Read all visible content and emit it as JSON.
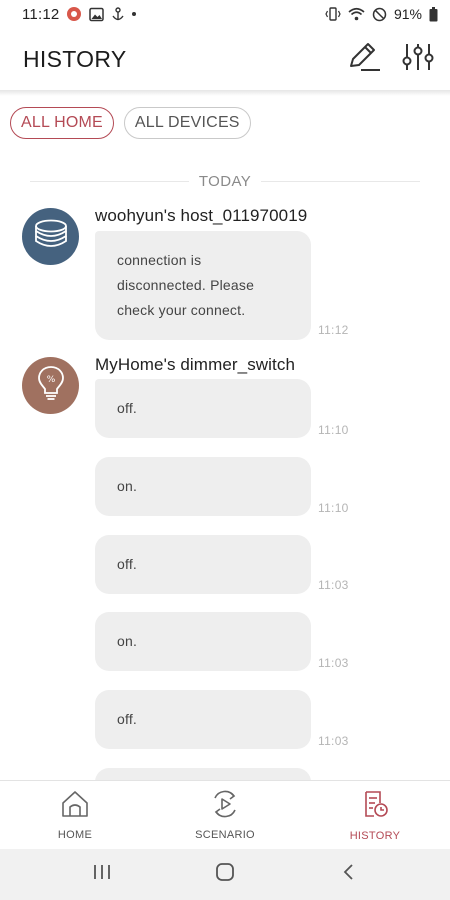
{
  "status_bar": {
    "time": "11:12",
    "battery": "91%",
    "left_icons": [
      "app-notification-icon",
      "gallery-icon",
      "anchor-icon",
      "dot-icon"
    ],
    "right_icons": [
      "vibrate-icon",
      "wifi-icon",
      "do-not-disturb-icon",
      "battery-icon"
    ]
  },
  "header": {
    "title": "HISTORY",
    "edit_icon": "pencil-icon",
    "filter_icon": "sliders-icon"
  },
  "filters": {
    "all_home": "ALL HOME",
    "all_devices": "ALL DEVICES",
    "active": "ALL HOME"
  },
  "day_label": "TODAY",
  "groups": [
    {
      "device": "woohyun's host_011970019",
      "icon": "host-stack-icon",
      "messages": [
        {
          "text": "connection is disconnected. Please check your connect.",
          "time": "11:12"
        }
      ]
    },
    {
      "device": "MyHome's dimmer_switch",
      "icon": "dimmer-bulb-icon",
      "messages": [
        {
          "text": "off.",
          "time": "11:10"
        },
        {
          "text": "on.",
          "time": "11:10"
        },
        {
          "text": "off.",
          "time": "11:03"
        },
        {
          "text": "on.",
          "time": "11:03"
        },
        {
          "text": "off.",
          "time": "11:03"
        }
      ]
    }
  ],
  "bottom_nav": {
    "items": [
      {
        "label": "HOME",
        "icon": "home-icon"
      },
      {
        "label": "SCENARIO",
        "icon": "scenario-icon"
      },
      {
        "label": "HISTORY",
        "icon": "history-icon"
      }
    ],
    "active": "HISTORY"
  },
  "colors": {
    "accent": "#b44a55",
    "host_avatar": "#45627f",
    "bulb_avatar": "#a07160",
    "bubble": "#eeeeee"
  }
}
